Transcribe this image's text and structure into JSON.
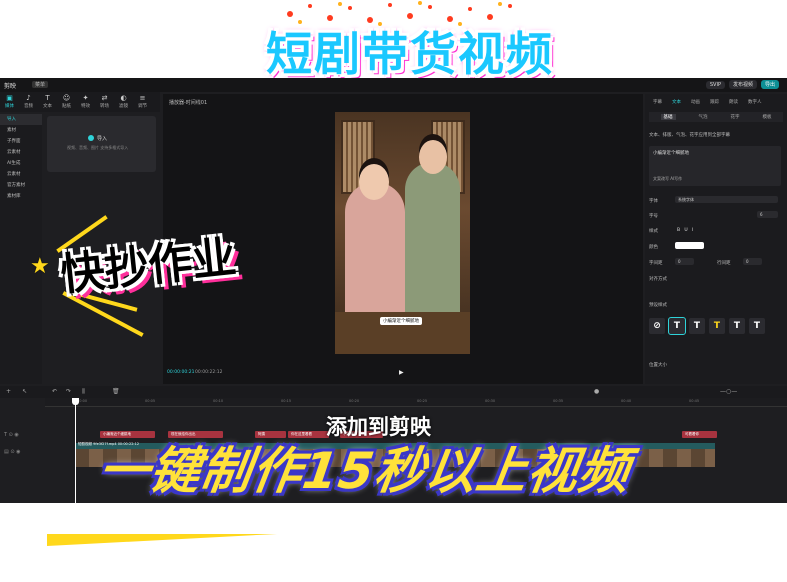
{
  "promo": {
    "top_title": "短剧带货视频",
    "handwriting": "快抄作业",
    "add_label": "添加到剪映",
    "bottom_banner": "一键制作15秒以上视频"
  },
  "menubar": {
    "app_name": "剪映",
    "menu": "菜单",
    "svip": "SVIP",
    "share": "发布视频",
    "export": "导出"
  },
  "left_tabs": [
    {
      "label": "媒体",
      "icon": "media-icon"
    },
    {
      "label": "音频",
      "icon": "audio-icon"
    },
    {
      "label": "文本",
      "icon": "text-icon"
    },
    {
      "label": "贴纸",
      "icon": "sticker-icon"
    },
    {
      "label": "特效",
      "icon": "effects-icon"
    },
    {
      "label": "转场",
      "icon": "transition-icon"
    },
    {
      "label": "滤镜",
      "icon": "filter-icon"
    },
    {
      "label": "调节",
      "icon": "adjust-icon"
    }
  ],
  "sidenav": [
    "导入",
    "素材",
    "子界面",
    "云素材",
    "AI生成",
    "云素材",
    "官方素材",
    "素材库"
  ],
  "import_box": {
    "label": "导入",
    "sub": "视频、音频、图片  支持多格式导入"
  },
  "player": {
    "header": "播放器-时间线01",
    "time": "00:00:00:21",
    "duration": "00:00:22:12",
    "caption": "小编渐近个细腻地"
  },
  "right_panel": {
    "tabs": [
      "字幕",
      "文本",
      "动画",
      "跟踪",
      "朗读",
      "数字人"
    ],
    "sub_tabs": [
      "基础",
      "气泡",
      "花字",
      "模板"
    ],
    "checkbox": "文本、排版、气泡、花字应用到全部字幕",
    "text_value": "小编渐近个细腻地",
    "ai_text": "文案改写  AI写作",
    "font_label": "字体",
    "font_value": "系统字体",
    "size_label": "字号",
    "size_value": "6",
    "style_label": "样式",
    "color_label": "颜色",
    "spacing_label": "字间距",
    "spacing_value": "0",
    "line_label": "行间距",
    "line_value": "0",
    "align_label": "对齐方式",
    "preset_label": "预设样式",
    "position_label": "位置大小"
  },
  "timeline": {
    "ticks": [
      "00:00",
      "00:05",
      "00:10",
      "00:15",
      "00:20",
      "00:25",
      "00:30",
      "00:35",
      "00:40",
      "00:45"
    ],
    "clips": [
      "小编渐近个细腻地",
      "现在就给你出出",
      "阿姨",
      "你在这里看看",
      "不好意思",
      "可看看你"
    ],
    "main_clip": "短剧视频  9fe3f27f.mp4 00:00:22:12"
  }
}
